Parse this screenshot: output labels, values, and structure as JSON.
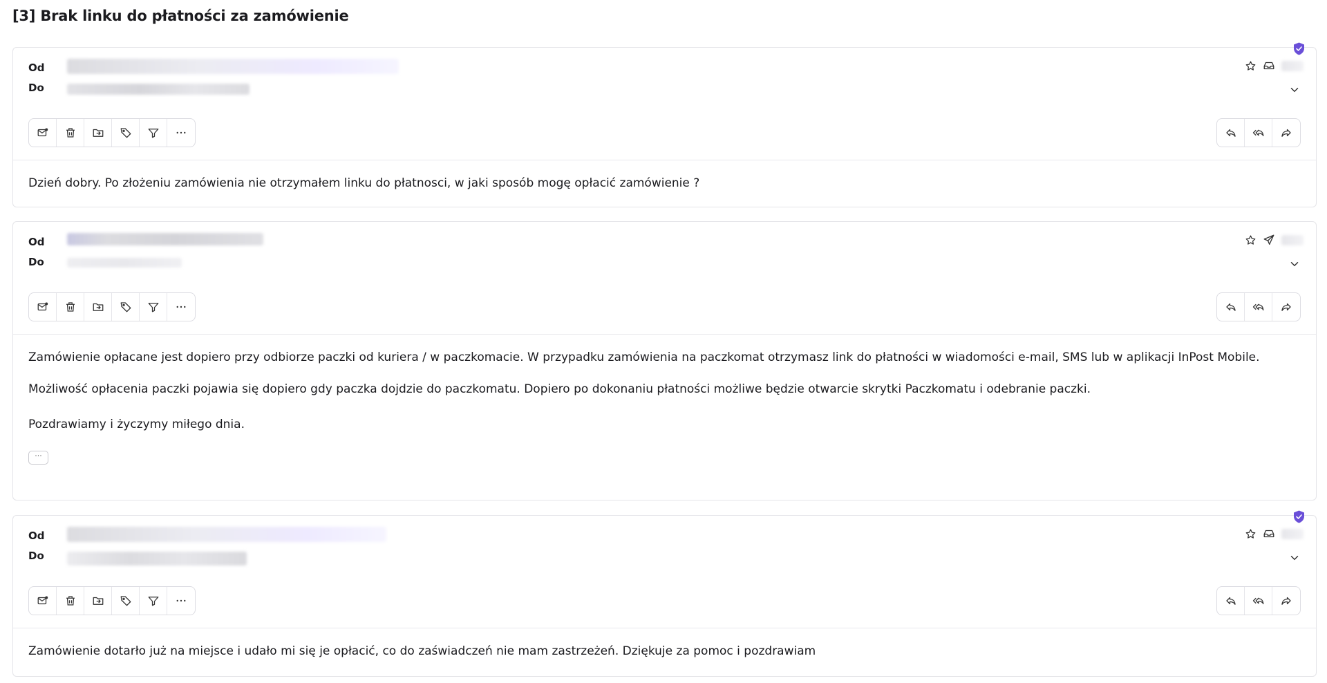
{
  "thread": {
    "title": "[3] Brak linku do płatności za zamówienie"
  },
  "labels": {
    "from": "Od",
    "to": "Do"
  },
  "icons": {
    "star": "star-icon",
    "inbox": "inbox-icon",
    "send": "send-icon",
    "shield": "shield-check-icon",
    "chevron": "chevron-down-icon",
    "toolbar_left": [
      "mark-unread-icon",
      "trash-icon",
      "move-folder-icon",
      "tag-icon",
      "filter-icon",
      "more-horizontal-icon"
    ],
    "toolbar_right": [
      "reply-icon",
      "reply-all-icon",
      "forward-icon"
    ]
  },
  "colors": {
    "accent": "#6a4fd8",
    "border": "#e4e4e8",
    "text": "#1b1b1f"
  },
  "messages": [
    {
      "direction": "inbound",
      "verified": true,
      "body": [
        "Dzień dobry. Po złożeniu zamówienia nie otrzymałem linku do płatnosci, w jaki sposób mogę opłacić zamówienie ?"
      ]
    },
    {
      "direction": "outbound",
      "verified": false,
      "body": [
        "Zamówienie opłacane jest dopiero przy odbiorze paczki od kuriera / w paczkomacie. W przypadku zamówienia na paczkomat otrzymasz link do płatności w wiadomości e-mail, SMS lub w aplikacji InPost Mobile.",
        "Możliwość opłacenia paczki pojawia się dopiero gdy paczka dojdzie do paczkomatu. Dopiero po dokonaniu płatności możliwe będzie otwarcie skrytki Paczkomatu i odebranie paczki.",
        "Pozdrawiamy i życzymy miłego dnia."
      ],
      "quoted_toggle": "···"
    },
    {
      "direction": "inbound",
      "verified": true,
      "body": [
        "Zamówienie dotarło już na miejsce i udało mi się je opłacić, co do zaświadczeń nie mam zastrzeżeń. Dziękuje za pomoc i pozdrawiam"
      ]
    }
  ]
}
